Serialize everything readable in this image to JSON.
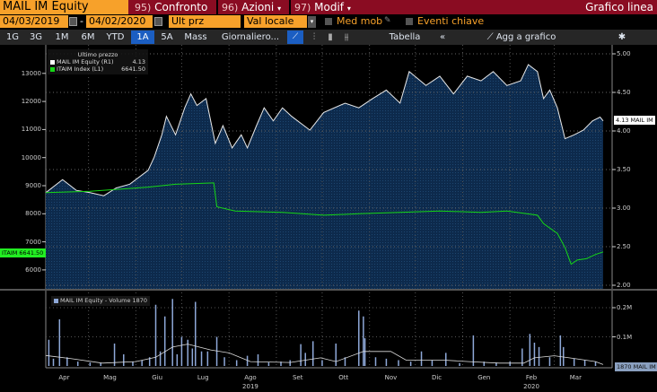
{
  "header": {
    "security": "MAIL IM Equity",
    "menus": [
      {
        "num": "95)",
        "label": "Confronto"
      },
      {
        "num": "96)",
        "label": "Azioni",
        "caret": "▾"
      },
      {
        "num": "97)",
        "label": "Modif",
        "caret": "▾"
      }
    ],
    "view_title": "Grafico linea"
  },
  "controls": {
    "start_date": "04/03/2019",
    "end_date": "04/02/2020",
    "field": "Ult prz",
    "currency": "Val locale",
    "moving_avg": "Med mob",
    "key_events": "Eventi chiave"
  },
  "toolbar": {
    "periods": [
      "1G",
      "3G",
      "1M",
      "6M",
      "YTD",
      "1A",
      "5A",
      "Mass"
    ],
    "active_period": "1A",
    "frequency": "Giornaliero...",
    "table": "Tabella",
    "collapse": "«",
    "add_to_chart": "Agg a grafico"
  },
  "colors": {
    "orange": "#f7a12a",
    "header_red": "#8a0c22",
    "price_fill": "#0d2a4c",
    "price_line": "#e8e8e8",
    "index_line": "#16d616",
    "volume_bars": "#8ea8d8",
    "active_tab": "#1b5ec2"
  },
  "chart_data": {
    "type": "line",
    "legend": {
      "title": "Ultimo prezzo",
      "entries": [
        {
          "name": "MAIL IM Equity  (R1)",
          "value": "4.13",
          "color": "#ffffff"
        },
        {
          "name": "ITAIM Index  (L1)",
          "value": "6641.50",
          "color": "#16d616"
        }
      ],
      "placement": "top-left"
    },
    "x_range": [
      "2019-04-03",
      "2020-04-02"
    ],
    "x_ticks": [
      {
        "label": "Apr",
        "date": "2019-04-15"
      },
      {
        "label": "Mag",
        "date": "2019-05-15"
      },
      {
        "label": "Giu",
        "date": "2019-06-15"
      },
      {
        "label": "Lug",
        "date": "2019-07-15"
      },
      {
        "label": "Ago",
        "date": "2019-08-15"
      },
      {
        "label": "Set",
        "date": "2019-09-15"
      },
      {
        "label": "Ott",
        "date": "2019-10-15"
      },
      {
        "label": "Nov",
        "date": "2019-11-15"
      },
      {
        "label": "Dic",
        "date": "2019-12-15"
      },
      {
        "label": "Gen",
        "date": "2020-01-15"
      },
      {
        "label": "Feb",
        "date": "2020-02-15"
      },
      {
        "label": "Mar",
        "date": "2020-03-15"
      }
    ],
    "year_labels": [
      {
        "label": "2019",
        "date": "2019-08-15"
      },
      {
        "label": "2020",
        "date": "2020-02-15"
      }
    ],
    "left_axis": {
      "ticks": [
        "6000",
        "7000",
        "8000",
        "9000",
        "10000",
        "11000",
        "12000",
        "13000"
      ]
    },
    "right_axis": {
      "ticks": [
        "2.00",
        "2.50",
        "3.00",
        "3.50",
        "4.00",
        "4.50",
        "5.00"
      ],
      "ylim": [
        2.0,
        5.0
      ],
      "grid": true
    },
    "price_series": {
      "name": "MAIL IM Equity",
      "axis": "right",
      "last_label": "4.13 MAIL IM",
      "points": [
        [
          "2019-04-03",
          3.2
        ],
        [
          "2019-04-14",
          3.37
        ],
        [
          "2019-04-23",
          3.23
        ],
        [
          "2019-05-02",
          3.2
        ],
        [
          "2019-05-11",
          3.16
        ],
        [
          "2019-05-19",
          3.26
        ],
        [
          "2019-05-28",
          3.31
        ],
        [
          "2019-06-09",
          3.49
        ],
        [
          "2019-06-13",
          3.66
        ],
        [
          "2019-06-18",
          3.95
        ],
        [
          "2019-06-21",
          4.19
        ],
        [
          "2019-06-27",
          3.95
        ],
        [
          "2019-07-03",
          4.3
        ],
        [
          "2019-07-07",
          4.48
        ],
        [
          "2019-07-11",
          4.33
        ],
        [
          "2019-07-17",
          4.42
        ],
        [
          "2019-07-23",
          3.84
        ],
        [
          "2019-07-28",
          4.07
        ],
        [
          "2019-08-03",
          3.78
        ],
        [
          "2019-08-09",
          3.95
        ],
        [
          "2019-08-13",
          3.78
        ],
        [
          "2019-08-19",
          4.07
        ],
        [
          "2019-08-24",
          4.3
        ],
        [
          "2019-08-30",
          4.13
        ],
        [
          "2019-09-05",
          4.3
        ],
        [
          "2019-09-11",
          4.19
        ],
        [
          "2019-09-23",
          4.01
        ],
        [
          "2019-10-02",
          4.24
        ],
        [
          "2019-10-16",
          4.36
        ],
        [
          "2019-10-25",
          4.3
        ],
        [
          "2019-11-03",
          4.42
        ],
        [
          "2019-11-12",
          4.53
        ],
        [
          "2019-11-21",
          4.36
        ],
        [
          "2019-11-27",
          4.77
        ],
        [
          "2019-12-08",
          4.59
        ],
        [
          "2019-12-17",
          4.71
        ],
        [
          "2019-12-26",
          4.48
        ],
        [
          "2020-01-04",
          4.71
        ],
        [
          "2020-01-13",
          4.65
        ],
        [
          "2020-01-21",
          4.77
        ],
        [
          "2020-01-30",
          4.59
        ],
        [
          "2020-02-08",
          4.65
        ],
        [
          "2020-02-13",
          4.86
        ],
        [
          "2020-02-19",
          4.77
        ],
        [
          "2020-02-23",
          4.42
        ],
        [
          "2020-02-27",
          4.53
        ],
        [
          "2020-03-03",
          4.3
        ],
        [
          "2020-03-08",
          3.9
        ],
        [
          "2020-03-14",
          3.95
        ],
        [
          "2020-03-20",
          4.01
        ],
        [
          "2020-03-26",
          4.13
        ],
        [
          "2020-03-31",
          4.18
        ],
        [
          "2020-04-02",
          4.13
        ]
      ]
    },
    "index_series": {
      "name": "ITAIM Index",
      "axis": "left",
      "last_label": "ITAIM 6641.50",
      "points": [
        [
          "2019-04-03",
          8750
        ],
        [
          "2019-05-02",
          8800
        ],
        [
          "2019-06-09",
          8950
        ],
        [
          "2019-06-27",
          9050
        ],
        [
          "2019-07-22",
          9100
        ],
        [
          "2019-07-24",
          8250
        ],
        [
          "2019-08-05",
          8100
        ],
        [
          "2019-09-05",
          8050
        ],
        [
          "2019-10-02",
          7950
        ],
        [
          "2019-10-25",
          8000
        ],
        [
          "2019-11-21",
          8050
        ],
        [
          "2019-12-17",
          8100
        ],
        [
          "2020-01-13",
          8050
        ],
        [
          "2020-01-30",
          8100
        ],
        [
          "2020-02-19",
          7950
        ],
        [
          "2020-02-23",
          7650
        ],
        [
          "2020-03-03",
          7300
        ],
        [
          "2020-03-08",
          6800
        ],
        [
          "2020-03-12",
          6200
        ],
        [
          "2020-03-16",
          6350
        ],
        [
          "2020-03-22",
          6400
        ],
        [
          "2020-03-28",
          6550
        ],
        [
          "2020-04-02",
          6641.5
        ]
      ]
    },
    "volume": {
      "legend": "MAIL IM Equity - Volume 1870",
      "last_label": "1870 MAIL IM",
      "axis_ticks": [
        {
          "label": "0.1M",
          "value": 100000
        },
        {
          "label": "0.2M",
          "value": 200000
        }
      ],
      "bars": [
        [
          "2019-04-05",
          90000
        ],
        [
          "2019-04-08",
          25000
        ],
        [
          "2019-04-12",
          160000
        ],
        [
          "2019-04-17",
          30000
        ],
        [
          "2019-04-24",
          15000
        ],
        [
          "2019-05-02",
          12000
        ],
        [
          "2019-05-09",
          10000
        ],
        [
          "2019-05-18",
          77000
        ],
        [
          "2019-05-24",
          40000
        ],
        [
          "2019-05-30",
          15000
        ],
        [
          "2019-06-05",
          20000
        ],
        [
          "2019-06-10",
          30000
        ],
        [
          "2019-06-14",
          210000
        ],
        [
          "2019-06-17",
          50000
        ],
        [
          "2019-06-20",
          170000
        ],
        [
          "2019-06-25",
          230000
        ],
        [
          "2019-06-28",
          40000
        ],
        [
          "2019-07-01",
          100000
        ],
        [
          "2019-07-05",
          90000
        ],
        [
          "2019-07-08",
          60000
        ],
        [
          "2019-07-10",
          220000
        ],
        [
          "2019-07-14",
          50000
        ],
        [
          "2019-07-18",
          50000
        ],
        [
          "2019-07-24",
          100000
        ],
        [
          "2019-07-29",
          30000
        ],
        [
          "2019-08-06",
          20000
        ],
        [
          "2019-08-13",
          35000
        ],
        [
          "2019-08-20",
          40000
        ],
        [
          "2019-08-27",
          12000
        ],
        [
          "2019-09-04",
          15000
        ],
        [
          "2019-09-10",
          20000
        ],
        [
          "2019-09-17",
          75000
        ],
        [
          "2019-09-20",
          45000
        ],
        [
          "2019-09-25",
          85000
        ],
        [
          "2019-10-01",
          20000
        ],
        [
          "2019-10-10",
          77000
        ],
        [
          "2019-10-16",
          30000
        ],
        [
          "2019-10-25",
          190000
        ],
        [
          "2019-10-28",
          170000
        ],
        [
          "2019-10-29",
          95000
        ],
        [
          "2019-11-05",
          30000
        ],
        [
          "2019-11-12",
          25000
        ],
        [
          "2019-11-20",
          20000
        ],
        [
          "2019-11-28",
          15000
        ],
        [
          "2019-12-05",
          50000
        ],
        [
          "2019-12-12",
          20000
        ],
        [
          "2019-12-21",
          45000
        ],
        [
          "2019-12-30",
          10000
        ],
        [
          "2020-01-08",
          105000
        ],
        [
          "2020-01-15",
          15000
        ],
        [
          "2020-01-23",
          12000
        ],
        [
          "2020-02-01",
          15000
        ],
        [
          "2020-02-09",
          60000
        ],
        [
          "2020-02-14",
          110000
        ],
        [
          "2020-02-17",
          80000
        ],
        [
          "2020-02-20",
          65000
        ],
        [
          "2020-02-27",
          30000
        ],
        [
          "2020-03-05",
          105000
        ],
        [
          "2020-03-07",
          65000
        ],
        [
          "2020-03-14",
          25000
        ],
        [
          "2020-03-21",
          20000
        ],
        [
          "2020-03-28",
          15000
        ]
      ],
      "moving_average": [
        [
          "2019-04-03",
          36000
        ],
        [
          "2019-04-20",
          25000
        ],
        [
          "2019-05-10",
          10000
        ],
        [
          "2019-06-01",
          15000
        ],
        [
          "2019-06-14",
          30000
        ],
        [
          "2019-06-25",
          65000
        ],
        [
          "2019-07-05",
          75000
        ],
        [
          "2019-07-20",
          55000
        ],
        [
          "2019-08-01",
          45000
        ],
        [
          "2019-08-15",
          15000
        ],
        [
          "2019-09-10",
          12000
        ],
        [
          "2019-09-30",
          28000
        ],
        [
          "2019-10-10",
          15000
        ],
        [
          "2019-10-28",
          50000
        ],
        [
          "2019-11-15",
          50000
        ],
        [
          "2019-11-25",
          20000
        ],
        [
          "2019-12-20",
          20000
        ],
        [
          "2020-01-05",
          15000
        ],
        [
          "2020-01-25",
          10000
        ],
        [
          "2020-02-10",
          10000
        ],
        [
          "2020-02-17",
          28000
        ],
        [
          "2020-03-01",
          35000
        ],
        [
          "2020-03-15",
          25000
        ],
        [
          "2020-03-28",
          15000
        ],
        [
          "2020-04-02",
          5000
        ]
      ]
    }
  }
}
